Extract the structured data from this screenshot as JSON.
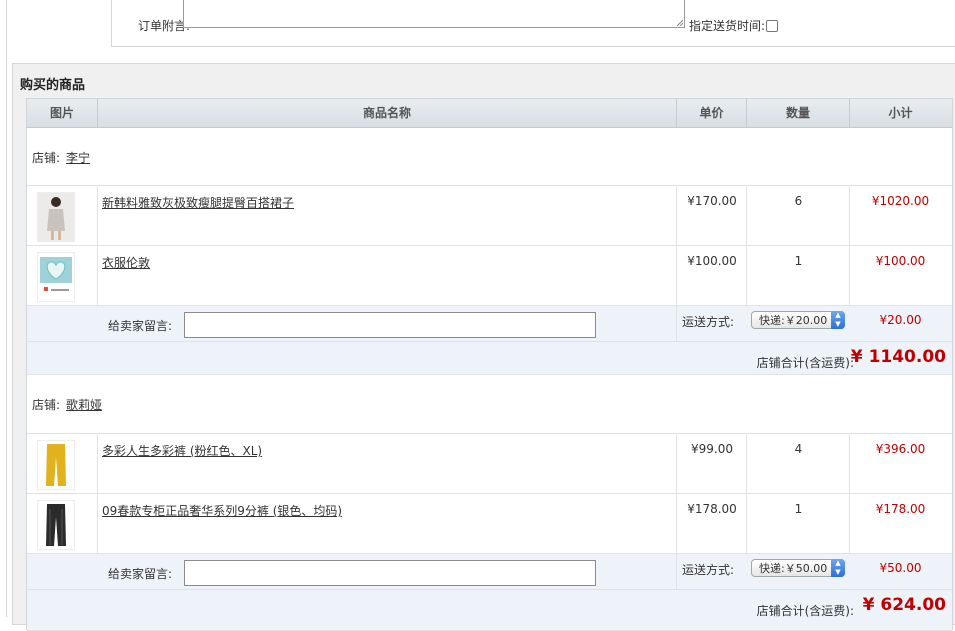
{
  "order_note": {
    "label": "订单附言:",
    "delivery_time_label": "指定送货时间:"
  },
  "section": {
    "title": "购买的商品"
  },
  "table_header": {
    "image": "图片",
    "name": "商品名称",
    "price": "单价",
    "qty": "数量",
    "subtotal": "小计"
  },
  "shop_label": "店铺:",
  "message_label": "给卖家留言:",
  "shipping_label": "运送方式:",
  "shop_total_label": "店铺合计(含运费):",
  "currency_symbol": "¥",
  "shops": [
    {
      "name": "李宁",
      "items": [
        {
          "name": "新韩料雅致灰极致瘦腿提臀百搭裙子",
          "price": "¥170.00",
          "qty": "6",
          "subtotal": "¥1020.00",
          "thumb_color": "#c9c3bd"
        },
        {
          "name": "衣服伦敦",
          "price": "¥100.00",
          "qty": "1",
          "subtotal": "¥100.00",
          "thumb_color": "#9fd2d8"
        }
      ],
      "shipping_option": "快递:￥20.00",
      "shipping_fee": "¥20.00",
      "total": "1140.00"
    },
    {
      "name": "歌莉娅",
      "items": [
        {
          "name": "多彩人生多彩裤 (粉红色、XL)",
          "price": "¥99.00",
          "qty": "4",
          "subtotal": "¥396.00",
          "thumb_color": "#e0b21e"
        },
        {
          "name": "09春款专柜正品奢华系列9分裤 (银色、均码)",
          "price": "¥178.00",
          "qty": "1",
          "subtotal": "¥178.00",
          "thumb_color": "#2b2b2b"
        }
      ],
      "shipping_option": "快递:￥50.00",
      "shipping_fee": "¥50.00",
      "total": "624.00"
    }
  ]
}
